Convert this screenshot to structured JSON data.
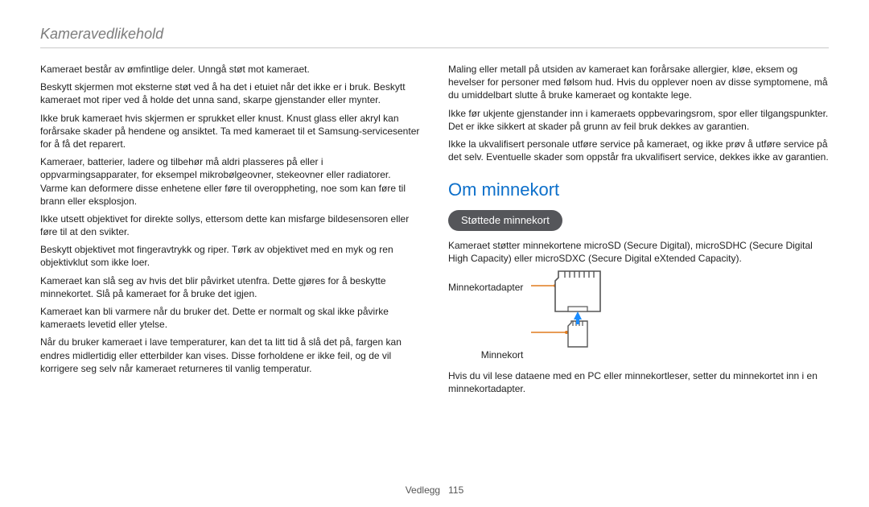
{
  "header": {
    "title": "Kameravedlikehold"
  },
  "left": {
    "p1": "Kameraet består av ømfintlige deler. Unngå støt mot kameraet.",
    "p2": "Beskytt skjermen mot eksterne støt ved å ha det i etuiet når det ikke er i bruk. Beskytt kameraet mot riper ved å holde det unna sand, skarpe gjenstander eller mynter.",
    "p3": "Ikke bruk kameraet hvis skjermen er sprukket eller knust. Knust glass eller akryl kan forårsake skader på hendene og ansiktet. Ta med kameraet til et Samsung-servicesenter for å få det reparert.",
    "p4": "Kameraer, batterier, ladere og tilbehør må aldri plasseres på eller i oppvarmingsapparater, for eksempel mikrobølgeovner, stekeovner eller radiatorer. Varme kan deformere disse enhetene eller føre til overoppheting, noe som kan føre til brann eller eksplosjon.",
    "p5": "Ikke utsett objektivet for direkte sollys, ettersom dette kan misfarge bildesensoren eller føre til at den svikter.",
    "p6": "Beskytt objektivet mot fingeravtrykk og riper. Tørk av objektivet med en myk og ren objektivklut som ikke loer.",
    "p7": "Kameraet kan slå seg av hvis det blir påvirket utenfra. Dette gjøres for å beskytte minnekortet. Slå på kameraet for å bruke det igjen.",
    "p8": "Kameraet kan bli varmere når du bruker det. Dette er normalt og skal ikke påvirke kameraets levetid eller ytelse.",
    "p9": "Når du bruker kameraet i lave temperaturer, kan det ta litt tid å slå det på, fargen kan endres midlertidig eller etterbilder kan vises. Disse forholdene er ikke feil, og de vil korrigere seg selv når kameraet returneres til vanlig temperatur."
  },
  "right": {
    "p1": "Maling eller metall på utsiden av kameraet kan forårsake allergier, kløe, eksem og hevelser for personer med følsom hud. Hvis du opplever noen av disse symptomene, må du umiddelbart slutte å bruke kameraet og kontakte lege.",
    "p2": "Ikke før ukjente gjenstander inn i kameraets oppbevaringsrom, spor eller tilgangspunkter. Det er ikke sikkert at skader på grunn av feil bruk dekkes av garantien.",
    "p3": "Ikke la ukvalifisert personale utføre service på kameraet, og ikke prøv å utføre service på det selv. Eventuelle skader som oppstår fra ukvalifisert service, dekkes ikke av garantien.",
    "sectionTitle": "Om minnekort",
    "pill": "Støttede minnekort",
    "p4": "Kameraet støtter minnekortene microSD (Secure Digital), microSDHC (Secure Digital High Capacity) eller microSDXC (Secure Digital eXtended Capacity).",
    "label1": "Minnekortadapter",
    "label2": "Minnekort",
    "p5": "Hvis du vil lese dataene med en PC eller minnekortleser, setter du minnekortet inn i en minnekortadapter."
  },
  "footer": {
    "section": "Vedlegg",
    "page": "115"
  }
}
